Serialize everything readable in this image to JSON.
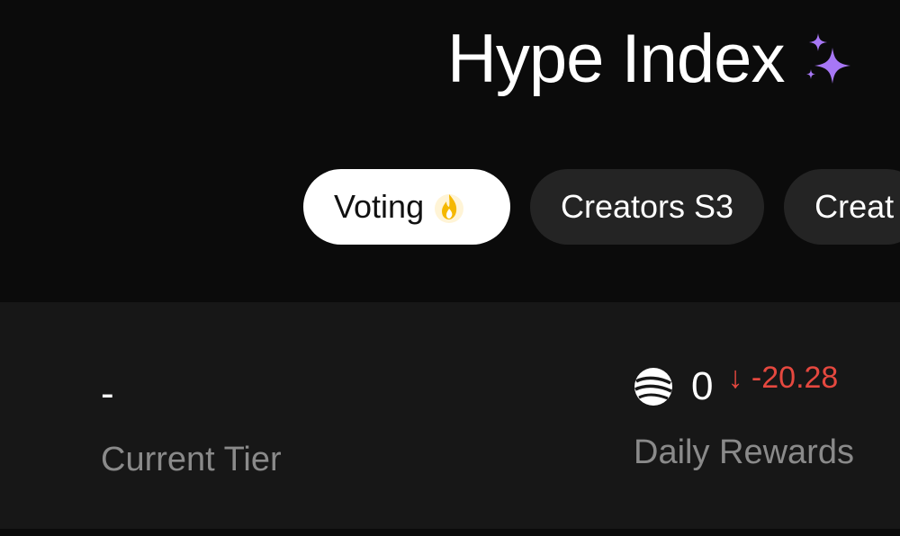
{
  "header": {
    "title": "Hype Index",
    "title_icon": "sparkle-icon",
    "tabs": [
      {
        "label": "Voting",
        "icon": "fire-icon",
        "active": true
      },
      {
        "label": "Creators S3",
        "active": false
      },
      {
        "label": "Creat",
        "active": false
      }
    ]
  },
  "stats": {
    "current_tier": {
      "value": "-",
      "label": "Current Tier"
    },
    "daily_rewards": {
      "value": "0",
      "delta": "↓ -20.28",
      "label": "Daily Rewards",
      "icon": "coin-icon"
    }
  },
  "colors": {
    "background": "#0b0b0b",
    "panel": "#171717",
    "tab_inactive": "#242424",
    "accent_purple": "#a777f5",
    "fire": "#f5b800",
    "negative": "#e5483f",
    "label": "#8a8a8a"
  }
}
